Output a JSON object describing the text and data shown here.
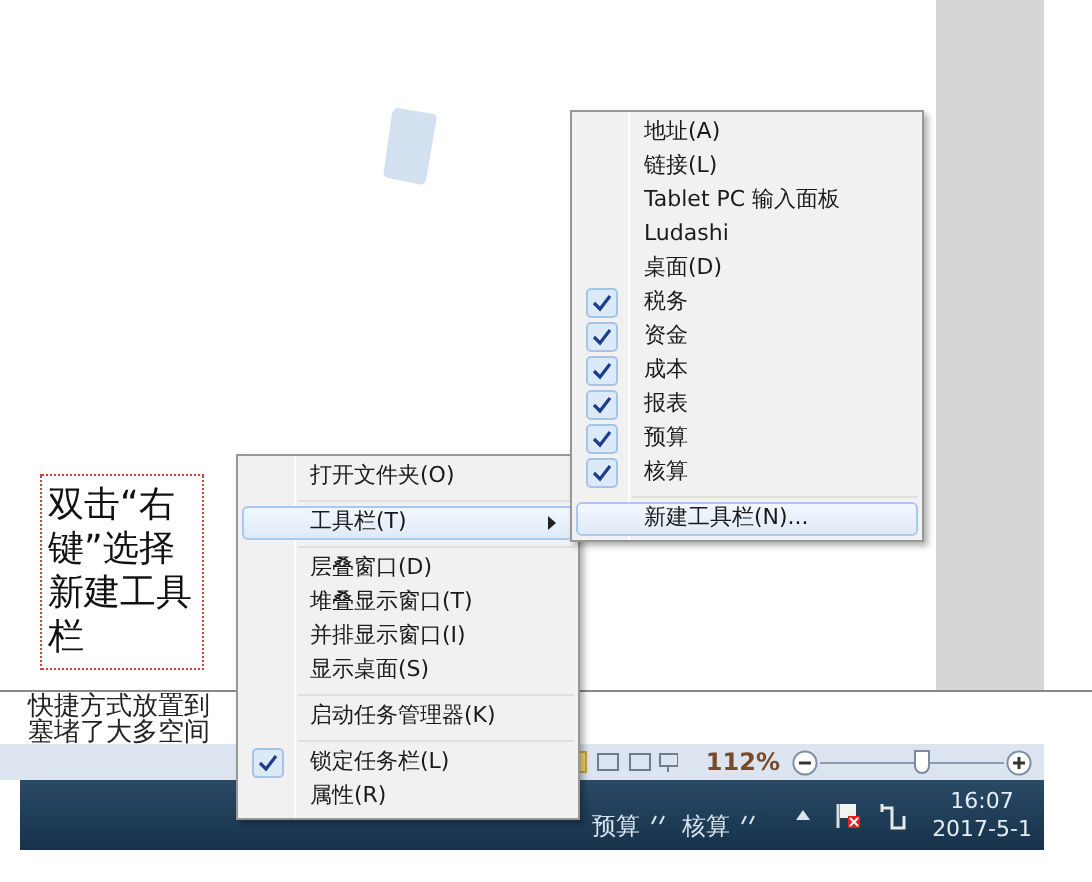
{
  "document": {
    "note": "双击“右键”选择新建工具栏",
    "lines": [
      "快捷方式放置到",
      "塞堵了大多空间"
    ]
  },
  "context_menu": {
    "items": [
      {
        "kind": "item",
        "label": "打开文件夹(O)",
        "selected": false,
        "checked": false,
        "submenu": false
      },
      {
        "kind": "separator"
      },
      {
        "kind": "item",
        "label": "工具栏(T)",
        "selected": true,
        "checked": false,
        "submenu": true
      },
      {
        "kind": "separator"
      },
      {
        "kind": "item",
        "label": "层叠窗口(D)",
        "selected": false,
        "checked": false,
        "submenu": false
      },
      {
        "kind": "item",
        "label": "堆叠显示窗口(T)",
        "selected": false,
        "checked": false,
        "submenu": false
      },
      {
        "kind": "item",
        "label": "并排显示窗口(I)",
        "selected": false,
        "checked": false,
        "submenu": false
      },
      {
        "kind": "item",
        "label": "显示桌面(S)",
        "selected": false,
        "checked": false,
        "submenu": false
      },
      {
        "kind": "separator"
      },
      {
        "kind": "item",
        "label": "启动任务管理器(K)",
        "selected": false,
        "checked": false,
        "submenu": false
      },
      {
        "kind": "separator"
      },
      {
        "kind": "item",
        "label": "锁定任务栏(L)",
        "selected": false,
        "checked": true,
        "submenu": false
      },
      {
        "kind": "item",
        "label": "属性(R)",
        "selected": false,
        "checked": false,
        "submenu": false
      }
    ]
  },
  "toolbar_submenu": {
    "items": [
      {
        "kind": "item",
        "label": "地址(A)",
        "selected": false,
        "checked": false
      },
      {
        "kind": "item",
        "label": "链接(L)",
        "selected": false,
        "checked": false
      },
      {
        "kind": "item",
        "label": "Tablet PC 输入面板",
        "selected": false,
        "checked": false
      },
      {
        "kind": "item",
        "label": "Ludashi",
        "selected": false,
        "checked": false
      },
      {
        "kind": "item",
        "label": "桌面(D)",
        "selected": false,
        "checked": false
      },
      {
        "kind": "item",
        "label": "税务",
        "selected": false,
        "checked": true
      },
      {
        "kind": "item",
        "label": "资金",
        "selected": false,
        "checked": true
      },
      {
        "kind": "item",
        "label": "成本",
        "selected": false,
        "checked": true
      },
      {
        "kind": "item",
        "label": "报表",
        "selected": false,
        "checked": true
      },
      {
        "kind": "item",
        "label": "预算",
        "selected": false,
        "checked": true
      },
      {
        "kind": "item",
        "label": "核算",
        "selected": false,
        "checked": true
      },
      {
        "kind": "separator"
      },
      {
        "kind": "item",
        "label": "新建工具栏(N)...",
        "selected": true,
        "checked": false
      }
    ]
  },
  "status_bar": {
    "zoom": "112%",
    "zoom_slider": {
      "level": 0.55
    }
  },
  "taskbar": {
    "toolbars": [
      {
        "label": "预算"
      },
      {
        "label": "核算"
      }
    ],
    "time": "16:07",
    "date": "2017-5-1"
  }
}
